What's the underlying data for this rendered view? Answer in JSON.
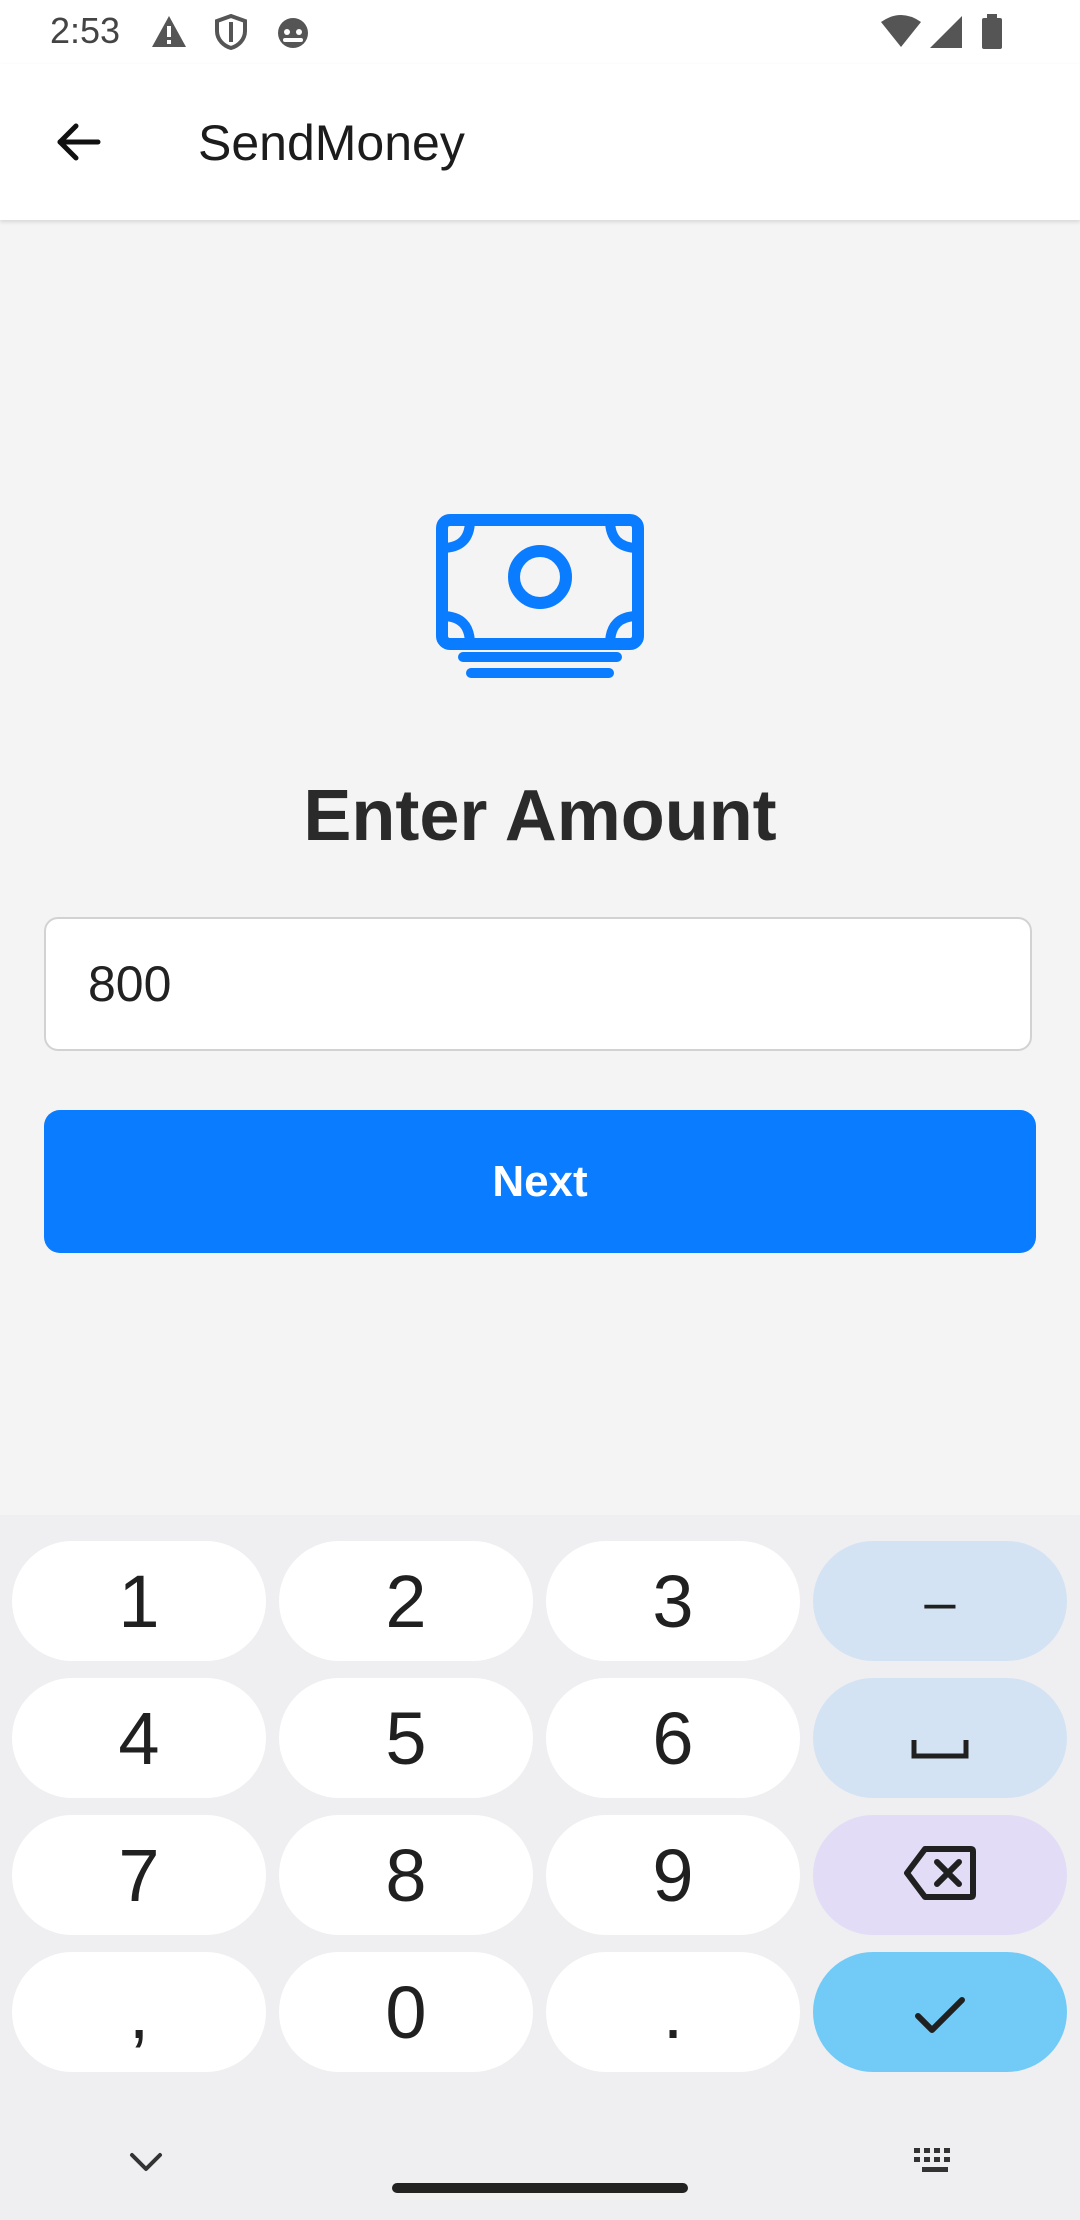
{
  "status_bar": {
    "time": "2:53",
    "left_icons": [
      "warning-icon",
      "shield-icon",
      "android-face-icon"
    ],
    "right_icons": [
      "wifi-icon",
      "signal-icon",
      "battery-icon"
    ]
  },
  "app_bar": {
    "title": "SendMoney",
    "back_icon": "arrow-back-icon"
  },
  "main": {
    "icon": "banknote-icon",
    "heading": "Enter Amount",
    "amount_value": "800",
    "next_label": "Next"
  },
  "keyboard": {
    "rows": [
      [
        "1",
        "2",
        "3",
        "–"
      ],
      [
        "4",
        "5",
        "6",
        "␣"
      ],
      [
        "7",
        "8",
        "9",
        "⌫"
      ],
      [
        ",",
        "0",
        ".",
        "✓"
      ]
    ],
    "hide_icon": "chevron-down-icon",
    "switch_icon": "keyboard-icon"
  },
  "colors": {
    "accent": "#0a7cff",
    "cursor": "#1fbfa8",
    "key_fn": "#d4e3f3",
    "key_delete": "#e2dcf6",
    "key_done": "#72cbf7"
  }
}
